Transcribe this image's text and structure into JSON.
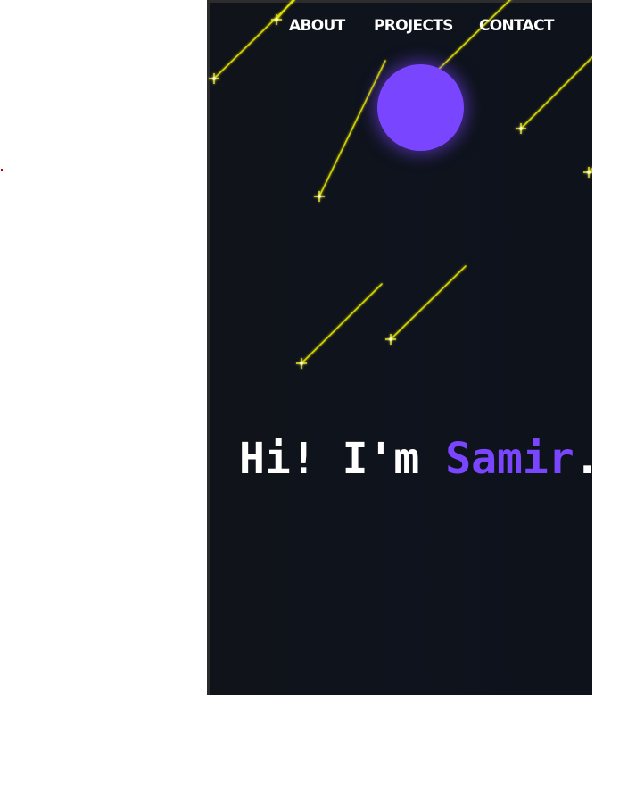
{
  "nav": {
    "about": "ABOUT",
    "projects": "PROJECTS",
    "contact": "CONTACT"
  },
  "hero": {
    "prefix": "Hi! I'm ",
    "name": "Samir",
    "suffix": "."
  },
  "colors": {
    "background": "#0e131d",
    "accent": "#7a45ff",
    "meteor": "#e6e600",
    "text": "#ffffff"
  }
}
